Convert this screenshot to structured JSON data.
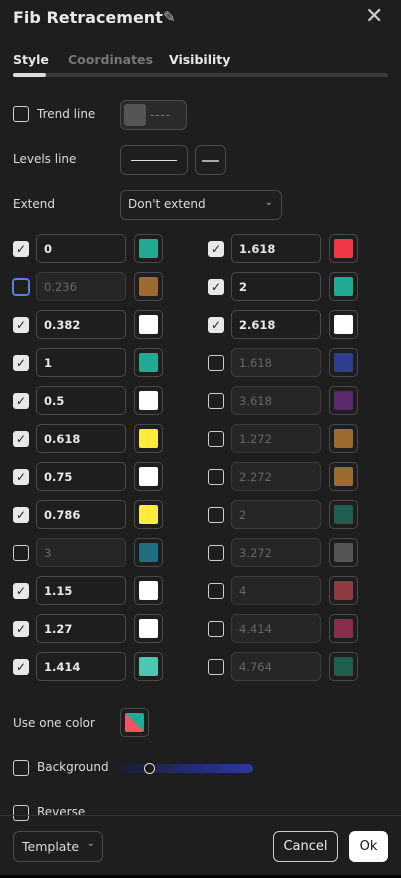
{
  "header": {
    "title": "Fib Retracement"
  },
  "tabs": [
    {
      "label": "Style"
    },
    {
      "label": "Coordinates"
    },
    {
      "label": "Visibility"
    }
  ],
  "trend_line": {
    "label": "Trend line",
    "checked": false
  },
  "levels_line": {
    "label": "Levels line"
  },
  "extend": {
    "label": "Extend",
    "value": "Don't extend"
  },
  "levels_left": [
    {
      "value": "0",
      "checked": true,
      "color": "#22ab94"
    },
    {
      "value": "0.236",
      "checked": false,
      "color": "#9c6b30"
    },
    {
      "value": "0.382",
      "checked": true,
      "color": "#ffffff"
    },
    {
      "value": "1",
      "checked": true,
      "color": "#22ab94"
    },
    {
      "value": "0.5",
      "checked": true,
      "color": "#ffffff"
    },
    {
      "value": "0.618",
      "checked": true,
      "color": "#ffeb3b"
    },
    {
      "value": "0.75",
      "checked": true,
      "color": "#ffffff"
    },
    {
      "value": "0.786",
      "checked": true,
      "color": "#ffeb3b"
    },
    {
      "value": "3",
      "checked": false,
      "color": "#1f6f80"
    },
    {
      "value": "1.15",
      "checked": true,
      "color": "#ffffff"
    },
    {
      "value": "1.27",
      "checked": true,
      "color": "#ffffff"
    },
    {
      "value": "1.414",
      "checked": true,
      "color": "#4dc7b1"
    }
  ],
  "levels_right": [
    {
      "value": "1.618",
      "checked": true,
      "color": "#f23645"
    },
    {
      "value": "2",
      "checked": true,
      "color": "#22ab94"
    },
    {
      "value": "2.618",
      "checked": true,
      "color": "#ffffff"
    },
    {
      "value": "1.618",
      "checked": false,
      "color": "#2e3f8f"
    },
    {
      "value": "3.618",
      "checked": false,
      "color": "#5b2a6e"
    },
    {
      "value": "1.272",
      "checked": false,
      "color": "#9c6b30"
    },
    {
      "value": "2.272",
      "checked": false,
      "color": "#9c6b30"
    },
    {
      "value": "2",
      "checked": false,
      "color": "#1e5f50"
    },
    {
      "value": "3.272",
      "checked": false,
      "color": "#555555"
    },
    {
      "value": "4",
      "checked": false,
      "color": "#8e3a40"
    },
    {
      "value": "4.414",
      "checked": false,
      "color": "#8a2d4a"
    },
    {
      "value": "4.764",
      "checked": false,
      "color": "#1e5f50"
    }
  ],
  "use_one_color": {
    "label": "Use one color"
  },
  "background": {
    "label": "Background",
    "checked": false,
    "opacity_percent": 20
  },
  "reverse": {
    "label": "Reverse",
    "checked": false
  },
  "footer": {
    "template_label": "Template",
    "cancel_label": "Cancel",
    "ok_label": "Ok"
  }
}
